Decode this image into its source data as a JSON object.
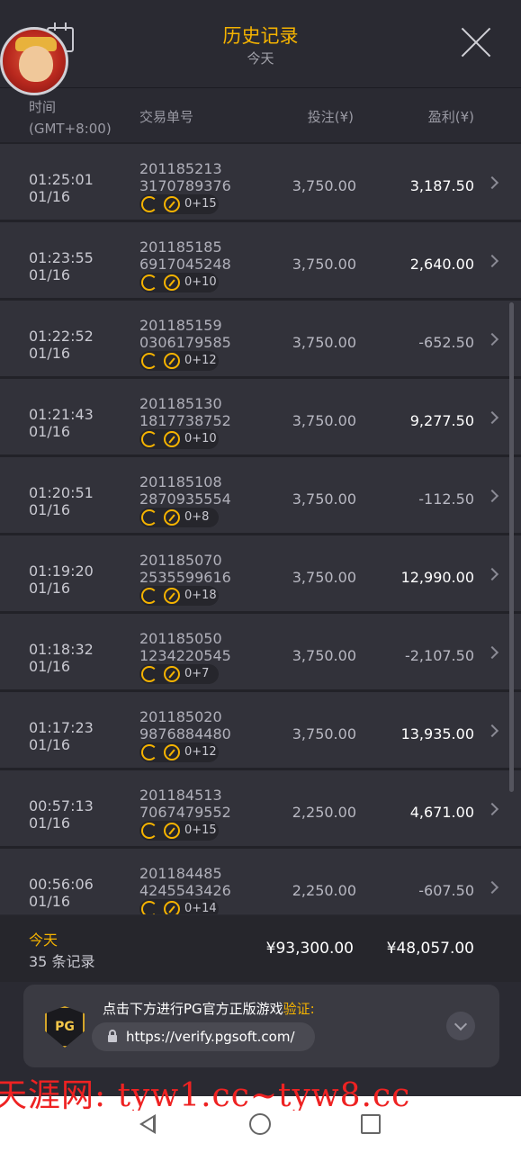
{
  "header": {
    "title": "历史记录",
    "subtitle": "今天"
  },
  "columns": {
    "time": "时间\n(GMT+8:00)",
    "order_id": "交易单号",
    "bet": "投注(¥)",
    "profit": "盈利(¥)"
  },
  "rows": [
    {
      "time": "01:25:01",
      "date": "01/16",
      "id_line1": "201185213",
      "id_line2": "3170789376",
      "free_spins": "0+15",
      "bet": "3,750.00",
      "profit": "3,187.50",
      "positive": true
    },
    {
      "time": "01:23:55",
      "date": "01/16",
      "id_line1": "201185185",
      "id_line2": "6917045248",
      "free_spins": "0+10",
      "bet": "3,750.00",
      "profit": "2,640.00",
      "positive": true
    },
    {
      "time": "01:22:52",
      "date": "01/16",
      "id_line1": "201185159",
      "id_line2": "0306179585",
      "free_spins": "0+12",
      "bet": "3,750.00",
      "profit": "-652.50",
      "positive": false
    },
    {
      "time": "01:21:43",
      "date": "01/16",
      "id_line1": "201185130",
      "id_line2": "1817738752",
      "free_spins": "0+10",
      "bet": "3,750.00",
      "profit": "9,277.50",
      "positive": true
    },
    {
      "time": "01:20:51",
      "date": "01/16",
      "id_line1": "201185108",
      "id_line2": "2870935554",
      "free_spins": "0+8",
      "bet": "3,750.00",
      "profit": "-112.50",
      "positive": false
    },
    {
      "time": "01:19:20",
      "date": "01/16",
      "id_line1": "201185070",
      "id_line2": "2535599616",
      "free_spins": "0+18",
      "bet": "3,750.00",
      "profit": "12,990.00",
      "positive": true
    },
    {
      "time": "01:18:32",
      "date": "01/16",
      "id_line1": "201185050",
      "id_line2": "1234220545",
      "free_spins": "0+7",
      "bet": "3,750.00",
      "profit": "-2,107.50",
      "positive": false
    },
    {
      "time": "01:17:23",
      "date": "01/16",
      "id_line1": "201185020",
      "id_line2": "9876884480",
      "free_spins": "0+12",
      "bet": "3,750.00",
      "profit": "13,935.00",
      "positive": true
    },
    {
      "time": "00:57:13",
      "date": "01/16",
      "id_line1": "201184513",
      "id_line2": "7067479552",
      "free_spins": "0+15",
      "bet": "2,250.00",
      "profit": "4,671.00",
      "positive": true
    },
    {
      "time": "00:56:06",
      "date": "01/16",
      "id_line1": "201184485",
      "id_line2": "4245543426",
      "free_spins": "0+14",
      "bet": "2,250.00",
      "profit": "-607.50",
      "positive": false
    }
  ],
  "footer": {
    "label": "今天",
    "count": "35 条记录",
    "total_bet": "¥93,300.00",
    "total_profit": "¥48,057.00"
  },
  "verify": {
    "text_main": "点击下方进行PG官方正版游戏",
    "text_highlight": "验证:",
    "badge": "PG",
    "url": "https://verify.pgsoft.com/"
  },
  "watermark": "天涯网: tyw1.cc~tyw8.cc",
  "colors": {
    "accent": "#f5b300",
    "background": "#2a2a32",
    "row": "#32323a",
    "watermark": "#ee2222"
  }
}
